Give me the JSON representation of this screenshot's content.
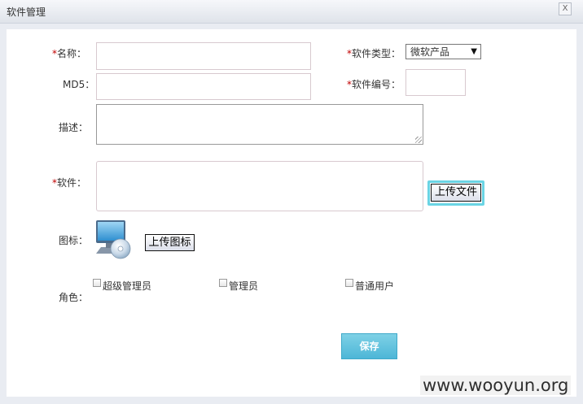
{
  "window": {
    "title": "软件管理",
    "close_label": "X"
  },
  "form": {
    "name_label": "名称：",
    "required_mark": "*",
    "type_label": "软件类型：",
    "type_selected": "微软产品",
    "md5_label": "MD5：",
    "serial_label": "软件编号：",
    "desc_label": "描述：",
    "software_label": "软件：",
    "upload_file_button": "上传文件",
    "icon_label": "图标：",
    "upload_icon_button": "上传图标",
    "role_label": "角色：",
    "roles": [
      "超级管理员",
      "管理员",
      "普通用户"
    ],
    "save_button": "保存"
  },
  "watermark": "www.wooyun.org",
  "icons": {
    "software_icon": "computer-disc-icon",
    "select_arrow": "triangle-down"
  }
}
